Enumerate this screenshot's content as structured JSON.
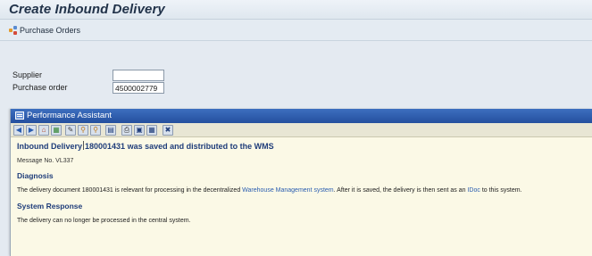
{
  "window": {
    "title": "Create Inbound Delivery"
  },
  "toolbar": {
    "purchase_orders_label": "Purchase Orders"
  },
  "form": {
    "supplier_label": "Supplier",
    "supplier_value": "",
    "purchase_order_label": "Purchase order",
    "purchase_order_value": "4500002779"
  },
  "performance_assistant": {
    "title": "Performance Assistant",
    "toolbar_icons": [
      "back-icon",
      "forward-icon",
      "home-icon",
      "structure-icon",
      "edit-icon",
      "find-icon",
      "find-next-icon",
      "technical-info-icon",
      "print-icon",
      "save-icon",
      "display-icon",
      "close-icon"
    ],
    "headline_part1": "Inbound Delivery",
    "headline_part2": "180001431 was saved and distributed to the WMS",
    "message_number": "Message No. VL337",
    "diagnosis_heading": "Diagnosis",
    "diagnosis_text_1": "The delivery document 180001431 is relevant for processing in the decentralized",
    "diagnosis_link_1": "Warehouse Management system",
    "diagnosis_text_2": ". After it is saved, the delivery is then sent as an",
    "diagnosis_link_2": "IDoc",
    "diagnosis_text_3": "to this system.",
    "system_response_heading": "System Response",
    "system_response_text": "The delivery can no longer be processed in the central system."
  },
  "colors": {
    "title_bar_blue": "#2d5aa8",
    "help_background": "#fbf9e6",
    "heading_blue": "#1f3d7a",
    "link_blue": "#2a5db0"
  }
}
